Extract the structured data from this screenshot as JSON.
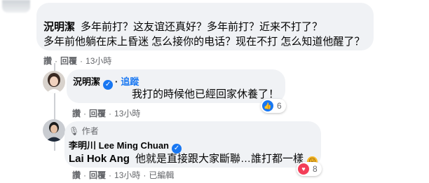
{
  "top_comment": {
    "author": "況明潔",
    "text_line1": "多年前打？这友谊还真好？多年前打？近来不打了？",
    "text_line2": "多年前他躺在床上昏迷 怎么接你的电话？现在不打 怎么知道他醒了？",
    "actions": {
      "like": "讚",
      "reply": "回覆",
      "time": "13小時"
    }
  },
  "reply_1": {
    "author": "況明潔",
    "follow": "追蹤",
    "text": "我打的時候他已經回家休養了！",
    "actions": {
      "like": "讚",
      "reply": "回覆",
      "time": "13小時"
    },
    "reaction": {
      "icon": "like-icon",
      "count": "6"
    }
  },
  "reply_2": {
    "badge": "作者",
    "author": "李明川 Lee Ming Chuan",
    "tag": "Lai Hok Ang",
    "text": "他就是直接跟大家斷聯…誰打都一樣",
    "emoji": "sad-face-emoji",
    "actions": {
      "like": "讚",
      "reply": "回覆",
      "time": "13小時",
      "edited": "已編輯"
    },
    "reaction": {
      "icon": "love-icon",
      "count": "8"
    }
  },
  "colors": {
    "bubble": "#f0f2f5",
    "link_blue": "#1877f2",
    "secondary_text": "#65676b",
    "love_red": "#f33e58"
  }
}
